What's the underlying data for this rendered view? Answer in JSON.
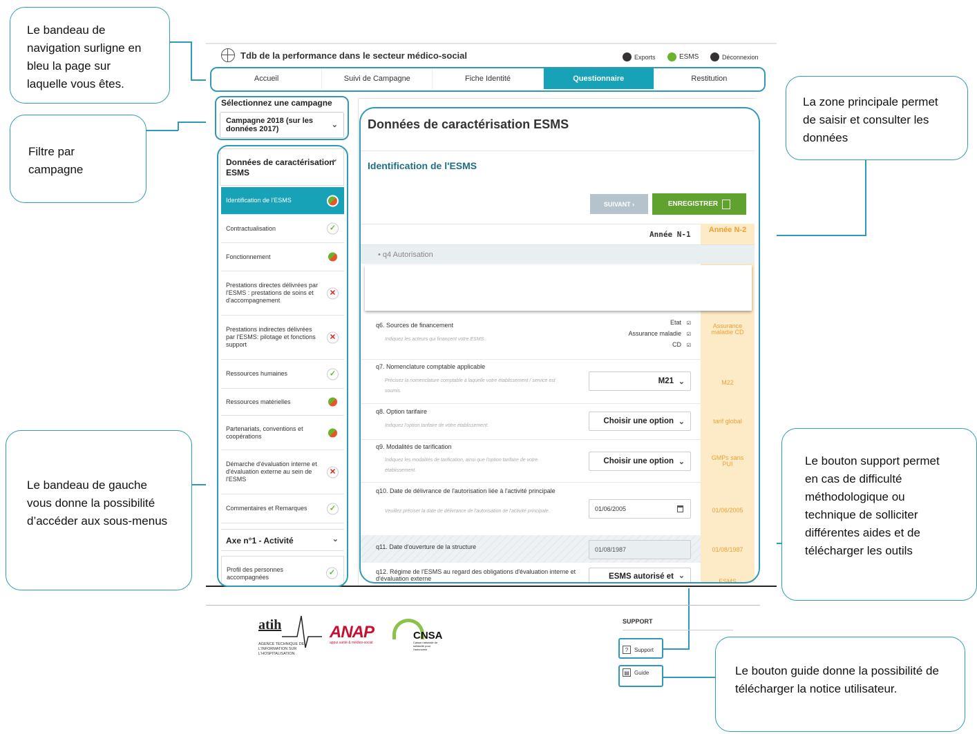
{
  "callouts": {
    "nav": "Le bandeau de navigation surligne en bleu la page sur laquelle vous êtes.",
    "filter": "Filtre par campagne",
    "sidebar": "Le bandeau de gauche vous donne la possibilité d’accéder aux sous-menus",
    "main": "La zone principale permet de saisir et consulter les données",
    "support": "Le bouton support permet en cas de difficulté méthodologique ou technique de solliciter différentes aides et de télécharger les outils",
    "guide": "Le bouton guide donne la possibilité de télécharger la notice utilisateur."
  },
  "app": {
    "title": "Tdb de la performance dans le secteur médico-social",
    "top_actions": {
      "exports": "Exports",
      "esms": "ESMS",
      "logout": "Déconnexion"
    },
    "nav": [
      "Accueil",
      "Suivi de Campagne",
      "Fiche Identité",
      "Questionnaire",
      "Restitution"
    ],
    "nav_active": "Questionnaire"
  },
  "sidebar": {
    "campaign_label": "Sélectionnez une campagne",
    "campaign_value": "Campagne 2018 (sur les données 2017)",
    "section": "Données de caractérisation ESMS",
    "items": [
      {
        "label": "Identification de l'ESMS",
        "status": "partial"
      },
      {
        "label": "Contractualisation",
        "status": "ok"
      },
      {
        "label": "Fonctionnement",
        "status": "partial"
      },
      {
        "label": "Prestations directes délivrées par l'ESMS : prestations de soins et d'accompagnement",
        "status": "ko"
      },
      {
        "label": "Prestations indirectes délivrées par l'ESMS: pilotage et fonctions support",
        "status": "ko"
      },
      {
        "label": "Ressources humaines",
        "status": "ok"
      },
      {
        "label": "Ressources matérielles",
        "status": "partial"
      },
      {
        "label": "Partenariats, conventions et coopérations",
        "status": "partial"
      },
      {
        "label": "Démarche d'évaluation interne et d'évaluation externe au sein de l'ESMS",
        "status": "ko"
      },
      {
        "label": "Commentaires et Remarques",
        "status": "ok"
      }
    ],
    "axe": "Axe n°1 - Activité",
    "profil": "Profil des personnes accompagnées",
    "status_icons": {
      "ok": "✓",
      "ko": "✕",
      "partial": ""
    }
  },
  "main": {
    "title": "Données de caractérisation ESMS",
    "subtitle": "Identification de l'ESMS",
    "btn_next": "SUIVANT  ›",
    "btn_save": "ENREGISTRER",
    "year_n1": "Année N-1",
    "year_n2": "Année N-2",
    "q4": "• q4 Autorisation",
    "q6": {
      "label": "q6. Sources de financement",
      "hint": "Indiquez les acteurs qui financent votre ESMS.",
      "checks": [
        "Etat",
        "Assurance maladie",
        "CD"
      ],
      "n2": "Assurance maladie CD"
    },
    "q7": {
      "label": "q7. Nomenclature comptable applicable",
      "hint": "Précisez la nomenclature comptable à laquelle votre établissement / service est soumis.",
      "value": "M21",
      "n2": "M22"
    },
    "q8": {
      "label": "q8. Option tarifaire",
      "hint": "Indiquez  l'option tarifaire de votre établissement.",
      "value": "Choisir une option",
      "n2": "tarif global"
    },
    "q9": {
      "label": "q9. Modalités de tarification",
      "hint": "Indiquez les modalités de tarification, ainsi que l'option tarifaire de votre établissement.",
      "value": "Choisir une option",
      "n2": "GMPs sans PUI"
    },
    "q10": {
      "label": "q10. Date de délivrance de l'autorisation liée à  l'activité principale",
      "hint": "Veuillez préciser la date de délivrance de l'autorisation de l'activité principale.",
      "value": "01/06/2005",
      "n2": "01/06/2005"
    },
    "q11": {
      "label": "q11. Date d'ouverture de la structure",
      "value": "01/08/1987",
      "n2": "01/08/1987"
    },
    "q12": {
      "label": "q12. Régime de l'ESMS au regard des obligations d'évaluation interne et d'évaluation externe",
      "value": "ESMS autorisé et",
      "n2": "ESMS"
    }
  },
  "footer": {
    "atih": "atih",
    "atih_sub": "AGENCE TECHNIQUE DE L'INFORMATION SUR L'HOSPITALISATION",
    "anap": "ANAP",
    "anap_sub": "appui santé & médico-social",
    "cnsa": "CNSA",
    "cnsa_sub": "Caisse nationale de solidarité pour l'autonomie",
    "support_title": "SUPPORT",
    "support_btn": "Support",
    "guide_btn": "Guide"
  },
  "colors": {
    "accent": "#17a2b8",
    "callout_border": "#2f9ab8",
    "save": "#5fa22d",
    "n2_bg": "#fdebc8"
  }
}
